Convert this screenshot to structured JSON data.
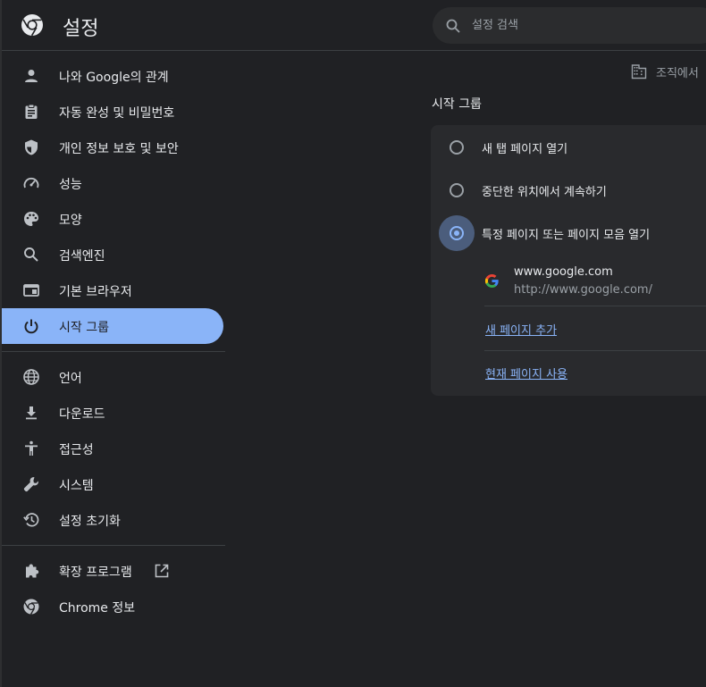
{
  "header": {
    "title": "설정",
    "logo_icon": "chrome-logo-icon",
    "search": {
      "placeholder": "설정 검색",
      "value": "",
      "icon": "search-icon"
    }
  },
  "sidebar": {
    "items": [
      {
        "label": "나와 Google의 관계",
        "icon": "person-icon"
      },
      {
        "label": "자동 완성 및 비밀번호",
        "icon": "clipboard-icon"
      },
      {
        "label": "개인 정보 보호 및 보안",
        "icon": "shield-icon"
      },
      {
        "label": "성능",
        "icon": "speedometer-icon"
      },
      {
        "label": "모양",
        "icon": "palette-icon"
      },
      {
        "label": "검색엔진",
        "icon": "search-icon"
      },
      {
        "label": "기본 브라우저",
        "icon": "browser-window-icon"
      },
      {
        "label": "시작 그룹",
        "icon": "power-icon",
        "active": true
      },
      {
        "label": "언어",
        "icon": "globe-icon"
      },
      {
        "label": "다운로드",
        "icon": "download-icon"
      },
      {
        "label": "접근성",
        "icon": "accessibility-icon"
      },
      {
        "label": "시스템",
        "icon": "wrench-icon"
      },
      {
        "label": "설정 초기화",
        "icon": "history-icon"
      },
      {
        "label": "확장 프로그램",
        "icon": "puzzle-icon",
        "external_icon": "open-in-new-icon"
      },
      {
        "label": "Chrome 정보",
        "icon": "chrome-logo-icon"
      }
    ]
  },
  "main": {
    "managed_notice": "조직에서",
    "managed_icon": "building-icon",
    "section_title": "시작 그룹",
    "options": [
      {
        "label": "새 탭 페이지 열기",
        "checked": false
      },
      {
        "label": "중단한 위치에서 계속하기",
        "checked": false
      },
      {
        "label": "특정 페이지 또는 페이지 모음 열기",
        "checked": true
      }
    ],
    "pages": [
      {
        "name": "www.google.com",
        "url": "http://www.google.com/",
        "favicon": "google-g-icon"
      }
    ],
    "add_page_link": "새 페이지 추가",
    "use_current_link": "현재 페이지 사용"
  },
  "colors": {
    "background": "#202124",
    "card": "#292a2d",
    "accent": "#8ab4f8",
    "text": "#e8eaed",
    "secondary_text": "#9aa0a6"
  }
}
